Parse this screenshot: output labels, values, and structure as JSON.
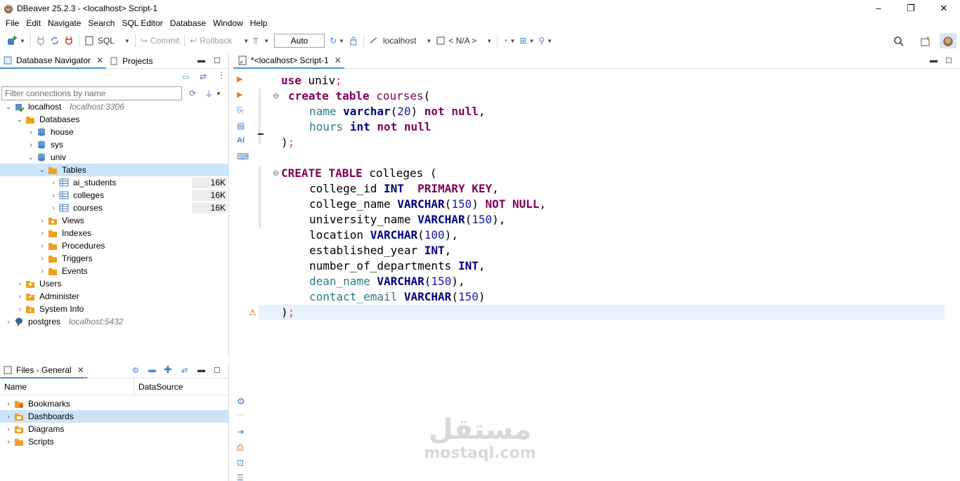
{
  "window": {
    "title": "DBeaver 25.2.3 - <localhost> Script-1",
    "minimize": "–",
    "restore": "❐",
    "close": "✕"
  },
  "menu": [
    "File",
    "Edit",
    "Navigate",
    "Search",
    "SQL Editor",
    "Database",
    "Window",
    "Help"
  ],
  "toolbar": {
    "sql_label": "SQL",
    "commit_label": "Commit",
    "rollback_label": "Rollback",
    "transaction_mode": "Auto",
    "active_connection": "localhost",
    "active_schema": "< N/A >"
  },
  "navigator": {
    "tab_label": "Database Navigator",
    "projects_tab_label": "Projects",
    "filter_placeholder": "Filter connections by name",
    "tree": [
      {
        "label": "localhost",
        "hint": "localhost:3306"
      },
      {
        "label": "Databases"
      },
      {
        "label": "house"
      },
      {
        "label": "sys"
      },
      {
        "label": "univ"
      },
      {
        "label": "Tables"
      },
      {
        "label": "ai_students",
        "size": "16K"
      },
      {
        "label": "colleges",
        "size": "16K"
      },
      {
        "label": "courses",
        "size": "16K"
      },
      {
        "label": "Views"
      },
      {
        "label": "Indexes"
      },
      {
        "label": "Procedures"
      },
      {
        "label": "Triggers"
      },
      {
        "label": "Events"
      },
      {
        "label": "Users"
      },
      {
        "label": "Administer"
      },
      {
        "label": "System Info"
      },
      {
        "label": "postgres",
        "hint": "localhost:5432"
      }
    ]
  },
  "files": {
    "tab_label": "Files - General",
    "col_name": "Name",
    "col_datasource": "DataSource",
    "items": [
      "Bookmarks",
      "Dashboards",
      "Diagrams",
      "Scripts"
    ]
  },
  "editor": {
    "tab_label": "*<localhost> Script-1",
    "gutter_ai_label": "AI",
    "lines": [
      "use univ;",
      "create table courses(",
      "name varchar(20) not null,",
      "hours int not null",
      ");",
      "CREATE TABLE colleges (",
      "college_id INT  PRIMARY KEY,",
      "college_name VARCHAR(150) NOT NULL,",
      "university_name VARCHAR(150),",
      "location VARCHAR(100),",
      "established_year INT,",
      "number_of_departments INT,",
      "dean_name VARCHAR(150),",
      "contact_email VARCHAR(150)",
      ");"
    ]
  },
  "watermark": {
    "arabic": "مستقل",
    "latin": "mostaql.com"
  }
}
